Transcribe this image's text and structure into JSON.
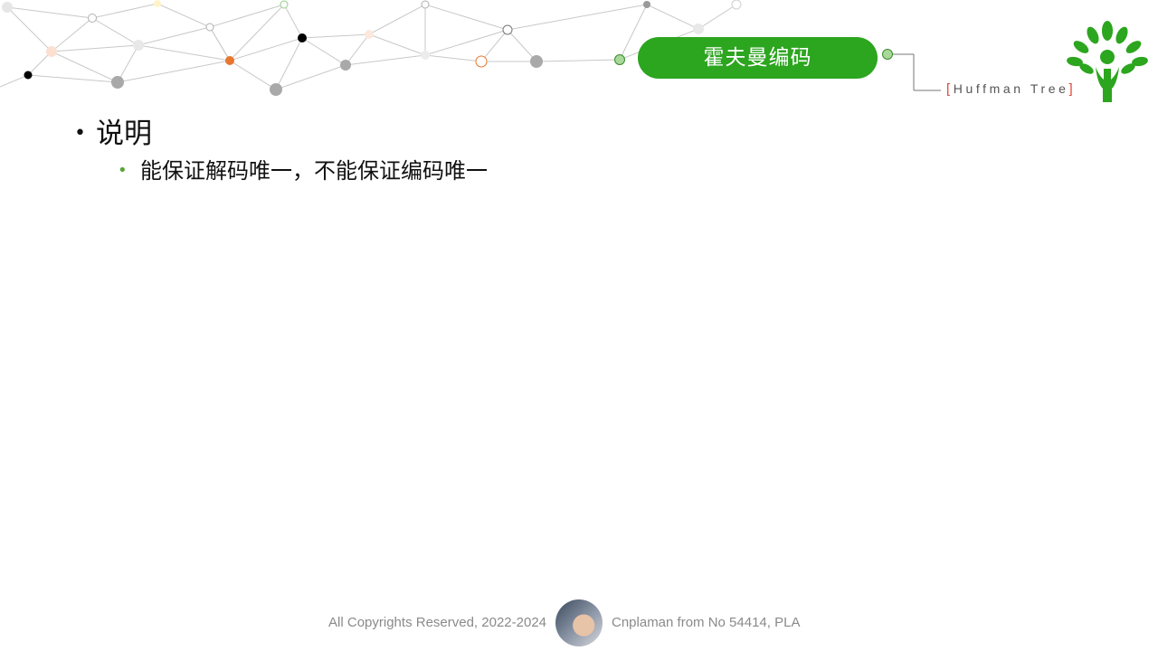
{
  "header": {
    "title": "霍夫曼编码",
    "subtitle_open": "[",
    "subtitle": "Huffman Tree",
    "subtitle_close": "]",
    "accent_color": "#2ca51f",
    "bracket_color": "#e0453a"
  },
  "logo": {
    "icon": "tree-hands-icon"
  },
  "content": {
    "bullets": [
      {
        "text": "说明",
        "children": [
          {
            "text": "能保证解码唯一，不能保证编码唯一"
          }
        ]
      }
    ]
  },
  "footer": {
    "copyright": "All Copyrights Reserved, 2022-2024",
    "author": "Cnplaman from No 54414, PLA",
    "avatar_icon": "author-avatar"
  }
}
